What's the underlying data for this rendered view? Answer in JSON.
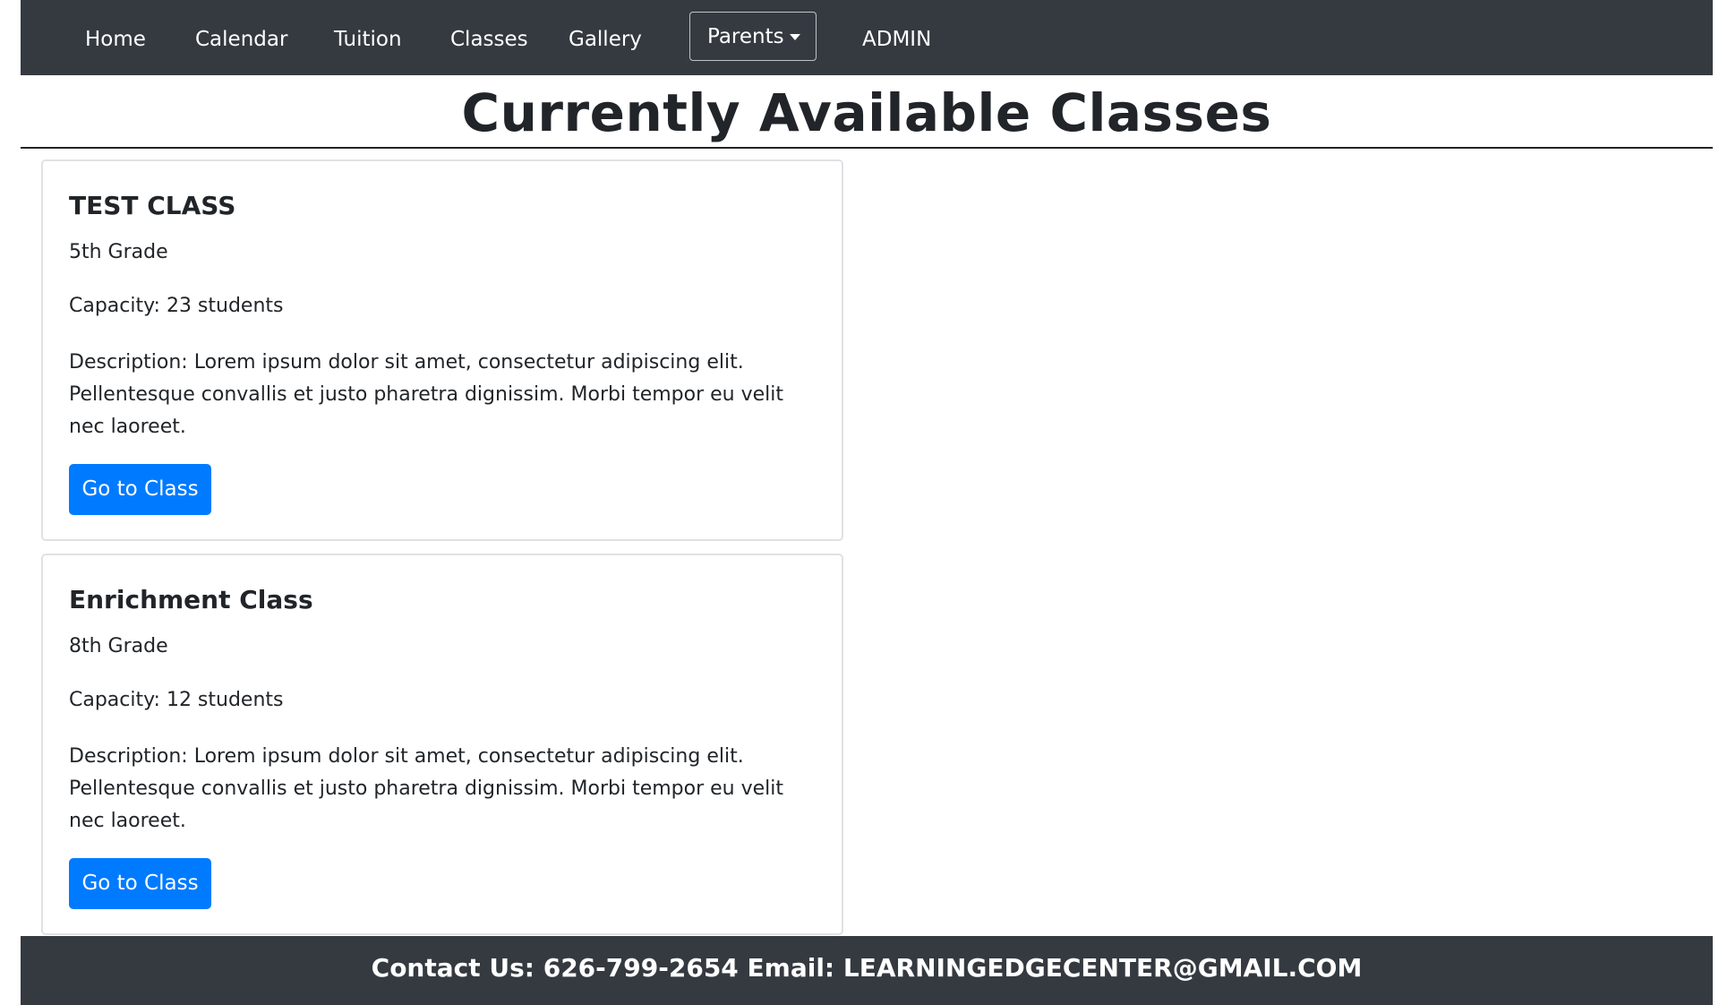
{
  "navbar": {
    "items": [
      "Home",
      "Calendar",
      "Tuition",
      "Classes",
      "Gallery"
    ],
    "dropdown_label": "Parents",
    "admin_label": "ADMIN"
  },
  "page_title": "Currently Available Classes",
  "classes": [
    {
      "title": "TEST CLASS",
      "grade": "5th Grade",
      "capacity": "Capacity: 23 students",
      "description": "Description: Lorem ipsum dolor sit amet, consectetur adipiscing elit. Pellentesque convallis et justo pharetra dignissim. Morbi tempor eu velit nec laoreet.",
      "button_label": "Go to Class"
    },
    {
      "title": "Enrichment Class",
      "grade": "8th Grade",
      "capacity": "Capacity: 12 students",
      "description": "Description: Lorem ipsum dolor sit amet, consectetur adipiscing elit. Pellentesque convallis et justo pharetra dignissim. Morbi tempor eu velit nec laoreet.",
      "button_label": "Go to Class"
    }
  ],
  "footer": {
    "contact_text": "Contact Us: 626-799-2654 Email: LEARNINGEDGECENTER@GMAIL.COM"
  },
  "colors": {
    "navbar_bg": "#343a40",
    "primary_button": "#007bff",
    "text": "#212529"
  }
}
